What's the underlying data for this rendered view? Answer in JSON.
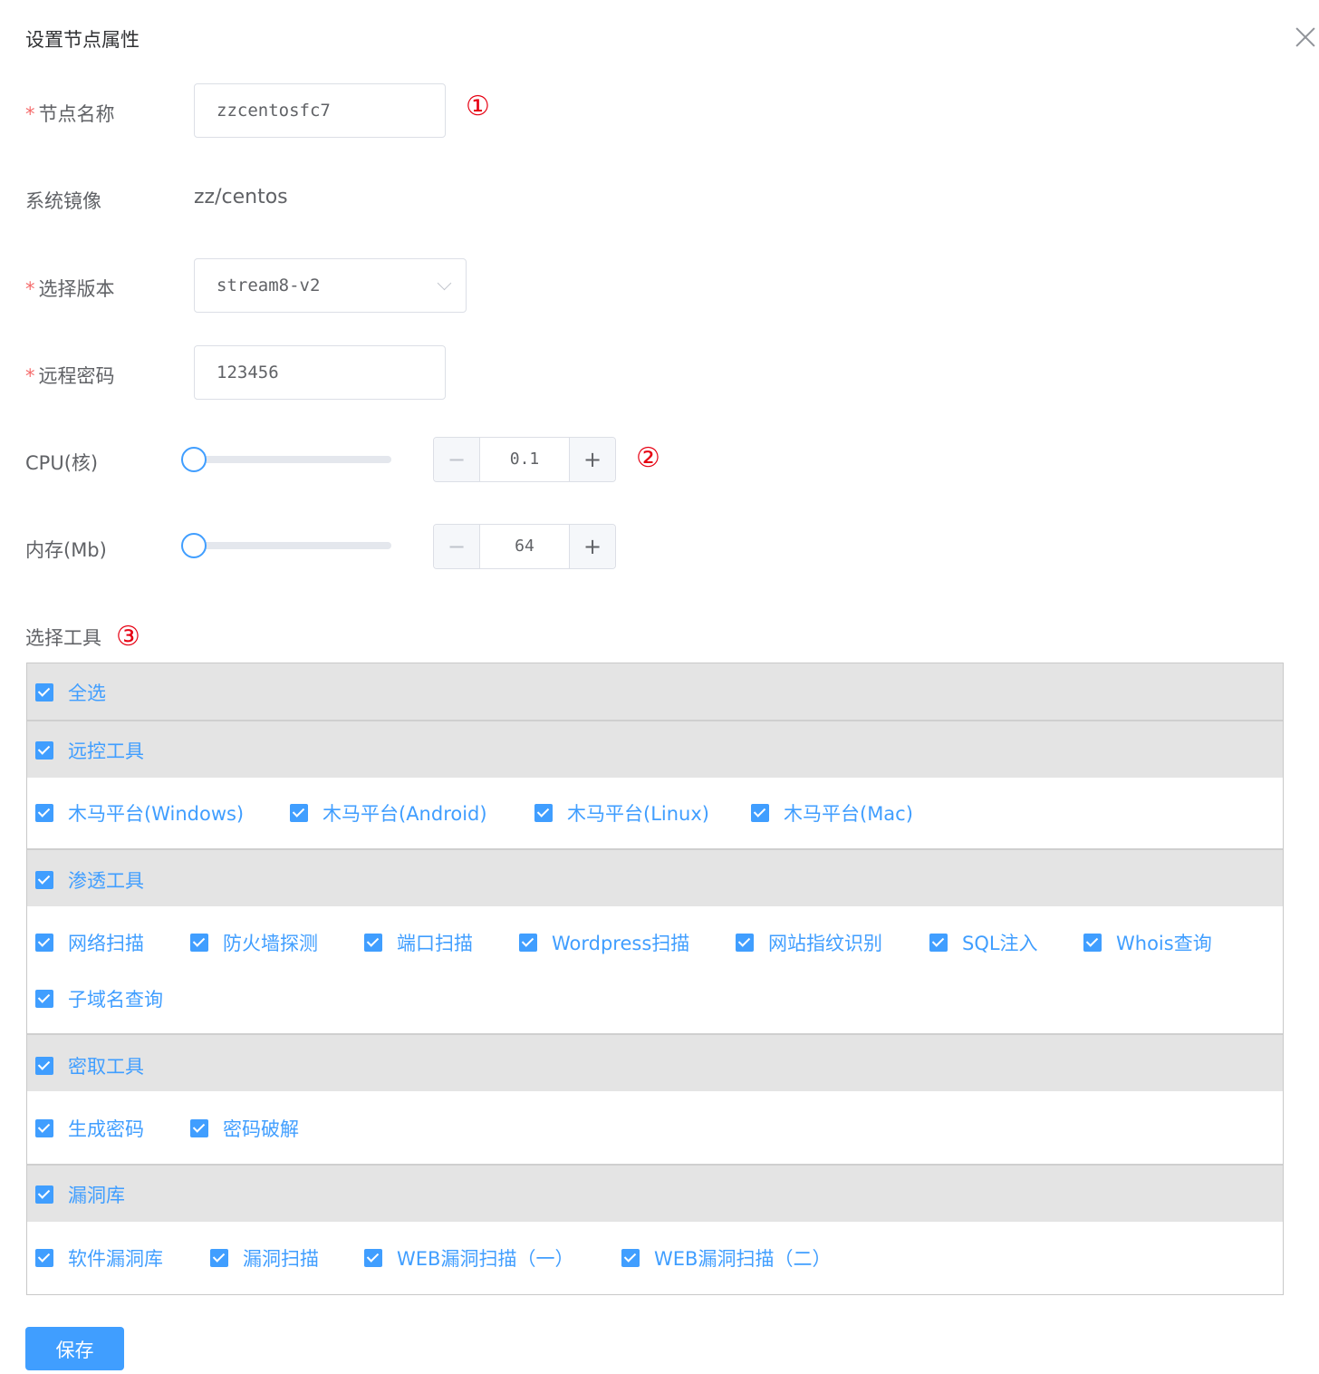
{
  "dialog": {
    "title": "设置节点属性"
  },
  "form": {
    "node_name": {
      "label": "节点名称",
      "value": "zzcentosfc7",
      "marker": "①"
    },
    "image": {
      "label": "系统镜像",
      "value": "zz/centos"
    },
    "version": {
      "label": "选择版本",
      "value": "stream8-v2"
    },
    "password": {
      "label": "远程密码",
      "value": "123456"
    },
    "cpu": {
      "label": "CPU(核)",
      "value": "0.1",
      "slider_fraction": 0,
      "marker": "②"
    },
    "memory": {
      "label": "内存(Mb)",
      "value": "64",
      "slider_fraction": 0
    },
    "tools_label": "选择工具",
    "tools_marker": "③"
  },
  "stepper": {
    "minus": "−",
    "plus": "+"
  },
  "tools": {
    "select_all": "全选",
    "groups": [
      {
        "name": "远控工具",
        "items": [
          "木马平台(Windows)",
          "木马平台(Android)",
          "木马平台(Linux)",
          "木马平台(Mac)"
        ]
      },
      {
        "name": "渗透工具",
        "items": [
          "网络扫描",
          "防火墙探测",
          "端口扫描",
          "Wordpress扫描",
          "网站指纹识别",
          "SQL注入",
          "Whois查询",
          "子域名查询"
        ]
      },
      {
        "name": "密取工具",
        "items": [
          "生成密码",
          "密码破解"
        ]
      },
      {
        "name": "漏洞库",
        "items": [
          "软件漏洞库",
          "漏洞扫描",
          "WEB漏洞扫描（一）",
          "WEB漏洞扫描（二）"
        ]
      }
    ]
  },
  "save_label": "保存",
  "colors": {
    "accent": "#409eff",
    "required": "#f56c6c",
    "marker": "#e60012",
    "group_header_bg": "#e4e4e4"
  }
}
